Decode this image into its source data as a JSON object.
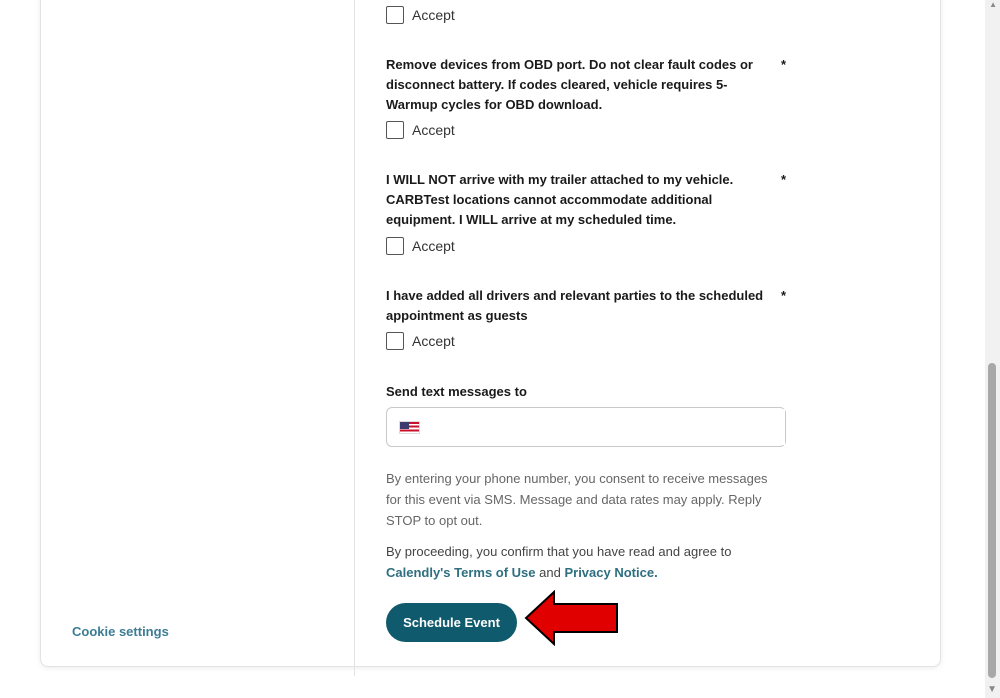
{
  "questions": [
    {
      "text": "",
      "required": false,
      "accept_label": "Accept"
    },
    {
      "text": "Remove devices from OBD port. Do not clear fault codes or disconnect battery. If codes cleared, vehicle requires 5-Warmup cycles for OBD download.",
      "required": "*",
      "accept_label": "Accept"
    },
    {
      "text": "I WILL NOT arrive with my trailer attached to my vehicle. CARBTest locations cannot accommodate additional equipment. I WILL arrive at my scheduled time.",
      "required": "*",
      "accept_label": "Accept"
    },
    {
      "text": "I have added all drivers and relevant parties to the scheduled appointment as guests",
      "required": "*",
      "accept_label": "Accept"
    }
  ],
  "sms": {
    "label": "Send text messages to",
    "flag_icon": "us-flag-icon",
    "value": ""
  },
  "consent_text": "By entering your phone number, you consent to receive messages for this event via SMS. Message and data rates may apply. Reply STOP to opt out.",
  "agree": {
    "prefix": "By proceeding, you confirm that you have read and agree to",
    "terms_link": "Calendly's Terms of Use",
    "and": "and",
    "privacy_link": "Privacy Notice",
    "suffix": "."
  },
  "schedule_button": "Schedule Event",
  "cookie_settings": "Cookie settings",
  "colors": {
    "accent": "#0f5a6c",
    "link": "#2e6f80",
    "annotation_arrow": "#e00000"
  }
}
